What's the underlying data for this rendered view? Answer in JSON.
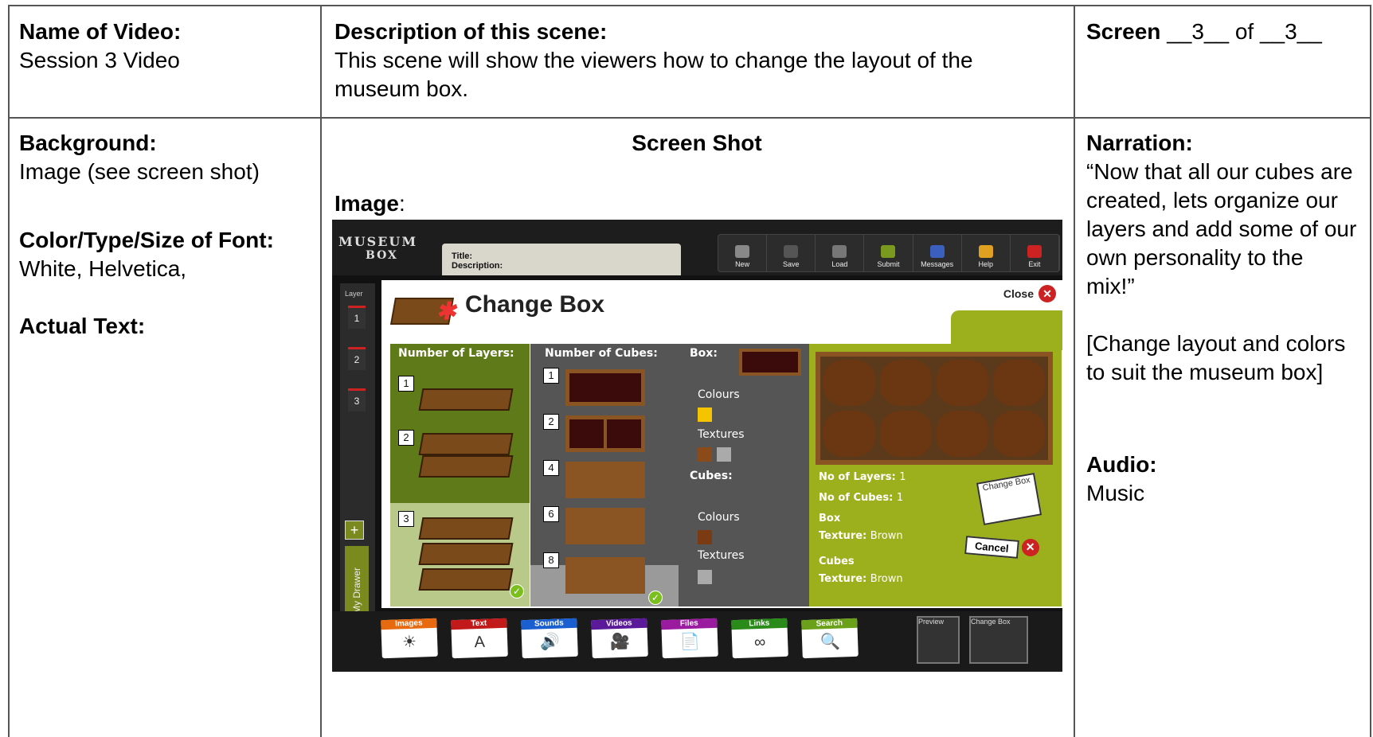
{
  "header": {
    "name_label": "Name of Video:",
    "name_value": "Session 3 Video",
    "desc_label": "Description of this scene:",
    "desc_value": "This scene will show the viewers how to change the layout of the museum box.",
    "screen_label": "Screen",
    "screen_text": "__3__ of __3__"
  },
  "left": {
    "bg_label": "Background:",
    "bg_value": "Image (see screen shot)",
    "font_label": "Color/Type/Size of Font:",
    "font_value": "White, Helvetica,",
    "actual_label": "Actual Text:"
  },
  "middle": {
    "heading": "Screen Shot",
    "image_label": "Image",
    "image_colon": ":"
  },
  "right": {
    "narration_label": "Narration:",
    "narration_value": "“Now that all our cubes are created, lets organize our layers and add some of our own personality to the mix!”",
    "note": "[Change layout and colors to suit the museum box]",
    "audio_label": "Audio:",
    "audio_value": "Music"
  },
  "app": {
    "logo_top": "MUSEUM",
    "logo_bottom": "BOX",
    "title_label": "Title:",
    "description_label": "Description:",
    "toolbar": [
      {
        "label": "New",
        "color": "#888"
      },
      {
        "label": "Save",
        "color": "#555"
      },
      {
        "label": "Load",
        "color": "#777"
      },
      {
        "label": "Submit",
        "color": "#7a9a1f"
      },
      {
        "label": "Messages",
        "color": "#3a5fbf"
      },
      {
        "label": "Help",
        "color": "#e0a020"
      },
      {
        "label": "Exit",
        "color": "#c22"
      }
    ],
    "layer_label": "Layer",
    "layers": [
      "1",
      "2",
      "3"
    ],
    "drawer_label": "My Drawer",
    "dialog": {
      "title": "Change Box",
      "close_label": "Close",
      "layers_header": "Number of Layers:",
      "cubes_header": "Number of Cubes:",
      "box_header": "Box:",
      "layer_options": [
        "1",
        "2",
        "3"
      ],
      "cube_options": [
        "1",
        "2",
        "4",
        "6",
        "8"
      ],
      "colours_label": "Colours",
      "textures_label": "Textures",
      "cubes_label": "Cubes:",
      "no_layers_label": "No of Layers:",
      "no_layers_value": "1",
      "no_cubes_label": "No of Cubes:",
      "no_cubes_value": "1",
      "box_label": "Box",
      "texture_label": "Texture:",
      "box_texture": "Brown",
      "cubes_label2": "Cubes",
      "cubes_texture": "Brown",
      "change_box_btn": "Change Box",
      "cancel_btn": "Cancel",
      "box_colour": "#f5c400",
      "cube_colour": "#7a3a12"
    },
    "bottom_tabs": [
      {
        "label": "Images",
        "color": "#e86a10",
        "glyph": "☀"
      },
      {
        "label": "Text",
        "color": "#c21a1a",
        "glyph": "A"
      },
      {
        "label": "Sounds",
        "color": "#1a5fd0",
        "glyph": "🔊"
      },
      {
        "label": "Videos",
        "color": "#5a1a9a",
        "glyph": "🎥"
      },
      {
        "label": "Files",
        "color": "#9a1aa0",
        "glyph": "📄"
      },
      {
        "label": "Links",
        "color": "#2a8a1a",
        "glyph": "∞"
      },
      {
        "label": "Search",
        "color": "#6aa01a",
        "glyph": "🔍"
      }
    ],
    "preview_label": "Preview",
    "changebox_label": "Change Box"
  }
}
